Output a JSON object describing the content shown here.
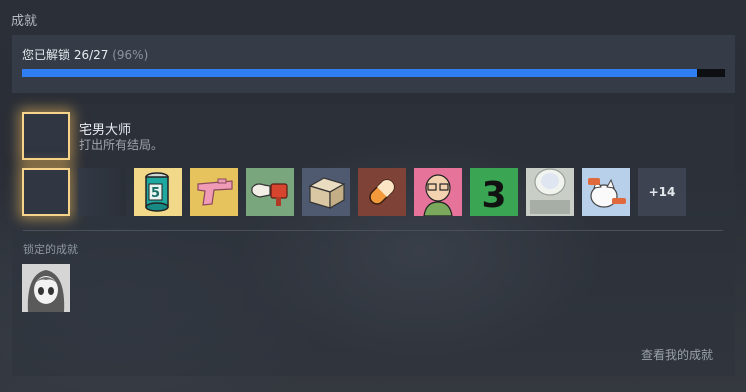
{
  "section_title": "成就",
  "progress": {
    "label": "您已解锁 26/27",
    "percent_text": "(96%)",
    "fraction": 0.96
  },
  "featured": {
    "title": "宅男大师",
    "description": "打出所有结局。"
  },
  "achievement_icons": [
    "blank-tile-icon",
    "dark-tile-icon",
    "green-can-icon",
    "pink-pistol-icon",
    "hand-bullet-icon",
    "cardboard-box-icon",
    "orange-pill-icon",
    "glasses-man-icon",
    "number-three-icon",
    "toilet-icon",
    "cat-guitar-icon"
  ],
  "can_number": "5",
  "badge_number": "3",
  "more_count": "+14",
  "locked": {
    "label": "锁定的成就",
    "icons": [
      "anime-girl-icon"
    ]
  },
  "view_link": "查看我的成就",
  "colors": {
    "accent": "#2f7ff2",
    "gold_frame": "#f6d489",
    "panel": "#373e4a"
  }
}
